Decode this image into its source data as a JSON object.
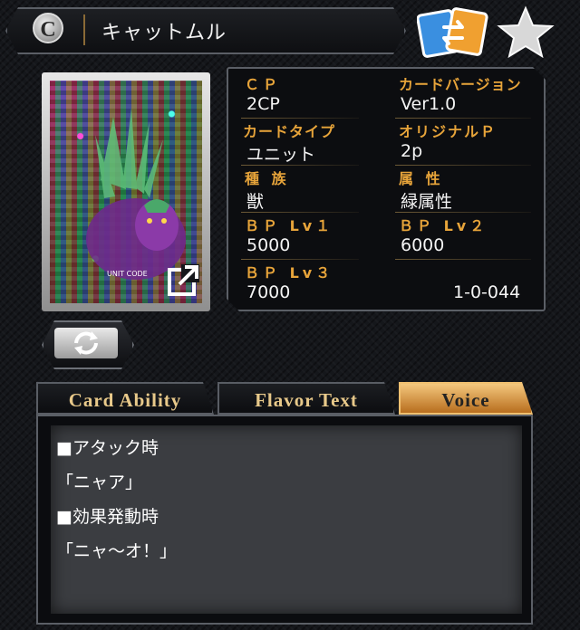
{
  "header": {
    "rarity_letter": "C",
    "card_name": "キャットムル"
  },
  "card": {
    "unit_code_label": "UNIT CODE"
  },
  "info": {
    "cp_label": "ＣＰ",
    "cp_value": "2CP",
    "version_label": "カードバージョン",
    "version_value": "Ver1.0",
    "type_label": "カードタイプ",
    "type_value": "ユニット",
    "original_label": "オリジナルＰ",
    "original_value": "2p",
    "tribe_label": "種 族",
    "tribe_value": "獣",
    "attribute_label": "属 性",
    "attribute_value": "緑属性",
    "bp1_label": "ＢＰ Lv１",
    "bp1_value": "5000",
    "bp2_label": "ＢＰ Lv２",
    "bp2_value": "6000",
    "bp3_label": "ＢＰ Lv３",
    "bp3_value": "7000",
    "card_number": "1-0-044"
  },
  "tabs": [
    {
      "label": "Card Ability",
      "active": false
    },
    {
      "label": "Flavor Text",
      "active": false
    },
    {
      "label": "Voice",
      "active": true
    }
  ],
  "voice_lines": [
    "■アタック時",
    "「ニャア」",
    "■効果発動時",
    "「ニャ～オ！」"
  ],
  "colors": {
    "label_gold": "#e7a43a",
    "tab_active": "#d9963f",
    "swap_blue": "#3a8fe0",
    "swap_orange": "#f0a030"
  }
}
